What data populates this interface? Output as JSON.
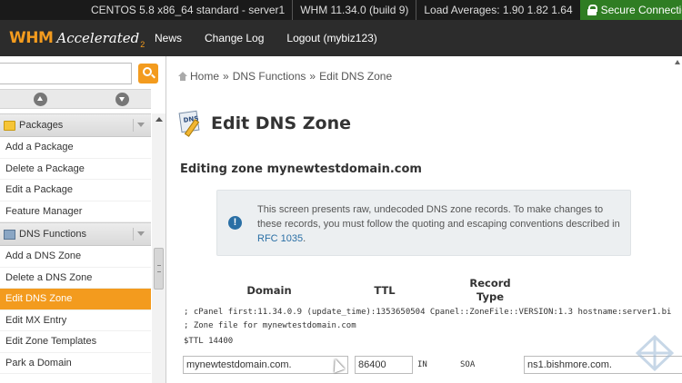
{
  "statusbar": {
    "server": "CENTOS 5.8 x86_64 standard - server1",
    "version": "WHM 11.34.0 (build 9)",
    "load": "Load Averages: 1.90 1.82 1.64",
    "secure": "Secure Connection"
  },
  "brand": {
    "whm": "WHM",
    "accelerated": "Accelerated",
    "version_sub": "2"
  },
  "topnav": {
    "news": "News",
    "changelog": "Change Log",
    "logout": "Logout (mybiz123)"
  },
  "search": {
    "placeholder": ""
  },
  "sidebar": {
    "packages_title": "Packages",
    "packages_items": [
      "Add a Package",
      "Delete a Package",
      "Edit a Package",
      "Feature Manager"
    ],
    "dns_title": "DNS Functions",
    "dns_items": [
      "Add a DNS Zone",
      "Delete a DNS Zone",
      "Edit DNS Zone",
      "Edit MX Entry",
      "Edit Zone Templates",
      "Park a Domain"
    ],
    "active_item": "Edit DNS Zone"
  },
  "breadcrumb": {
    "home": "Home",
    "section": "DNS Functions",
    "current": "Edit DNS Zone",
    "separator": "»"
  },
  "page": {
    "title": "Edit DNS Zone",
    "icon_tag": "DNS",
    "zone_heading": "Editing zone mynewtestdomain.com",
    "notice_text": "This screen presents raw, undecoded DNS zone records. To make changes to these records, you must follow the quoting and escaping conventions described in ",
    "notice_link": "RFC 1035",
    "notice_end": "."
  },
  "table": {
    "col_domain": "Domain",
    "col_ttl": "TTL",
    "col_type": "Record Type",
    "lines": [
      "; cPanel first:11.34.0.9 (update_time):1353650504 Cpanel::ZoneFile::VERSION:1.3 hostname:server1.bi",
      "; Zone file for mynewtestdomain.com",
      "$TTL 14400"
    ],
    "row": {
      "domain": "mynewtestdomain.com.",
      "ttl": "86400",
      "class": "IN",
      "type": "SOA",
      "value": "ns1.bishmore.com."
    }
  },
  "colors": {
    "accent": "#f39b1e",
    "secure_green": "#2f7d23",
    "link_blue": "#2a6fa5"
  }
}
